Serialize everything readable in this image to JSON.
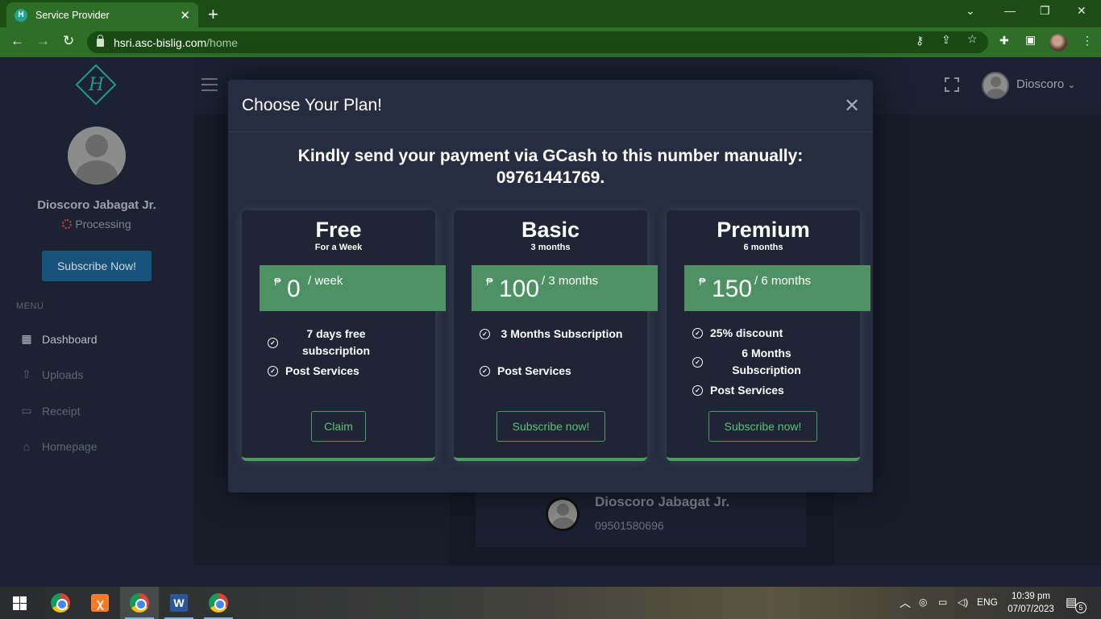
{
  "browser": {
    "tab_title": "Service Provider",
    "tab_close": "✕",
    "new_tab": "+",
    "url_host": "hsri.asc-bislig.com",
    "url_path": "/home"
  },
  "sidebar": {
    "logo_letter": "H",
    "user_name": "Dioscoro Jabagat Jr.",
    "status": "Processing",
    "subscribe_label": "Subscribe Now!",
    "menu_label": "MENU",
    "items": [
      {
        "label": "Dashboard",
        "icon": "dashboard-icon"
      },
      {
        "label": "Uploads",
        "icon": "upload-icon"
      },
      {
        "label": "Receipt",
        "icon": "receipt-icon"
      },
      {
        "label": "Homepage",
        "icon": "home-icon"
      }
    ]
  },
  "topbar": {
    "user_name": "Dioscoro",
    "caret": "⌄"
  },
  "profile_card": {
    "name": "Dioscoro Jabagat Jr.",
    "phone": "09501580696"
  },
  "modal": {
    "title": "Choose Your Plan!",
    "close": "✕",
    "message_line1": "Kindly send your payment via GCash to this number manually:",
    "message_line2": "09761441769.",
    "plans": [
      {
        "name": "Free",
        "subtitle": "For a Week",
        "currency": "₱",
        "amount": "0",
        "period": "/ week",
        "features": [
          "7 days free subscription",
          "Post Services"
        ],
        "button": "Claim"
      },
      {
        "name": "Basic",
        "subtitle": "3 months",
        "currency": "₱",
        "amount": "100",
        "period": "/ 3 months",
        "features": [
          "3 Months Subscription",
          "Post Services"
        ],
        "button": "Subscribe now!"
      },
      {
        "name": "Premium",
        "subtitle": "6 months",
        "currency": "₱",
        "amount": "150",
        "period": "/ 6 months",
        "features": [
          "25% discount",
          "6 Months Subscription",
          "Post Services"
        ],
        "button": "Subscribe now!"
      }
    ]
  },
  "taskbar": {
    "language": "ENG",
    "time": "10:39 pm",
    "date": "07/07/2023",
    "notification_count": "5"
  },
  "colors": {
    "accent_green": "#4e9264",
    "browser_green": "#2f6e26",
    "modal_bg": "#272d40"
  }
}
